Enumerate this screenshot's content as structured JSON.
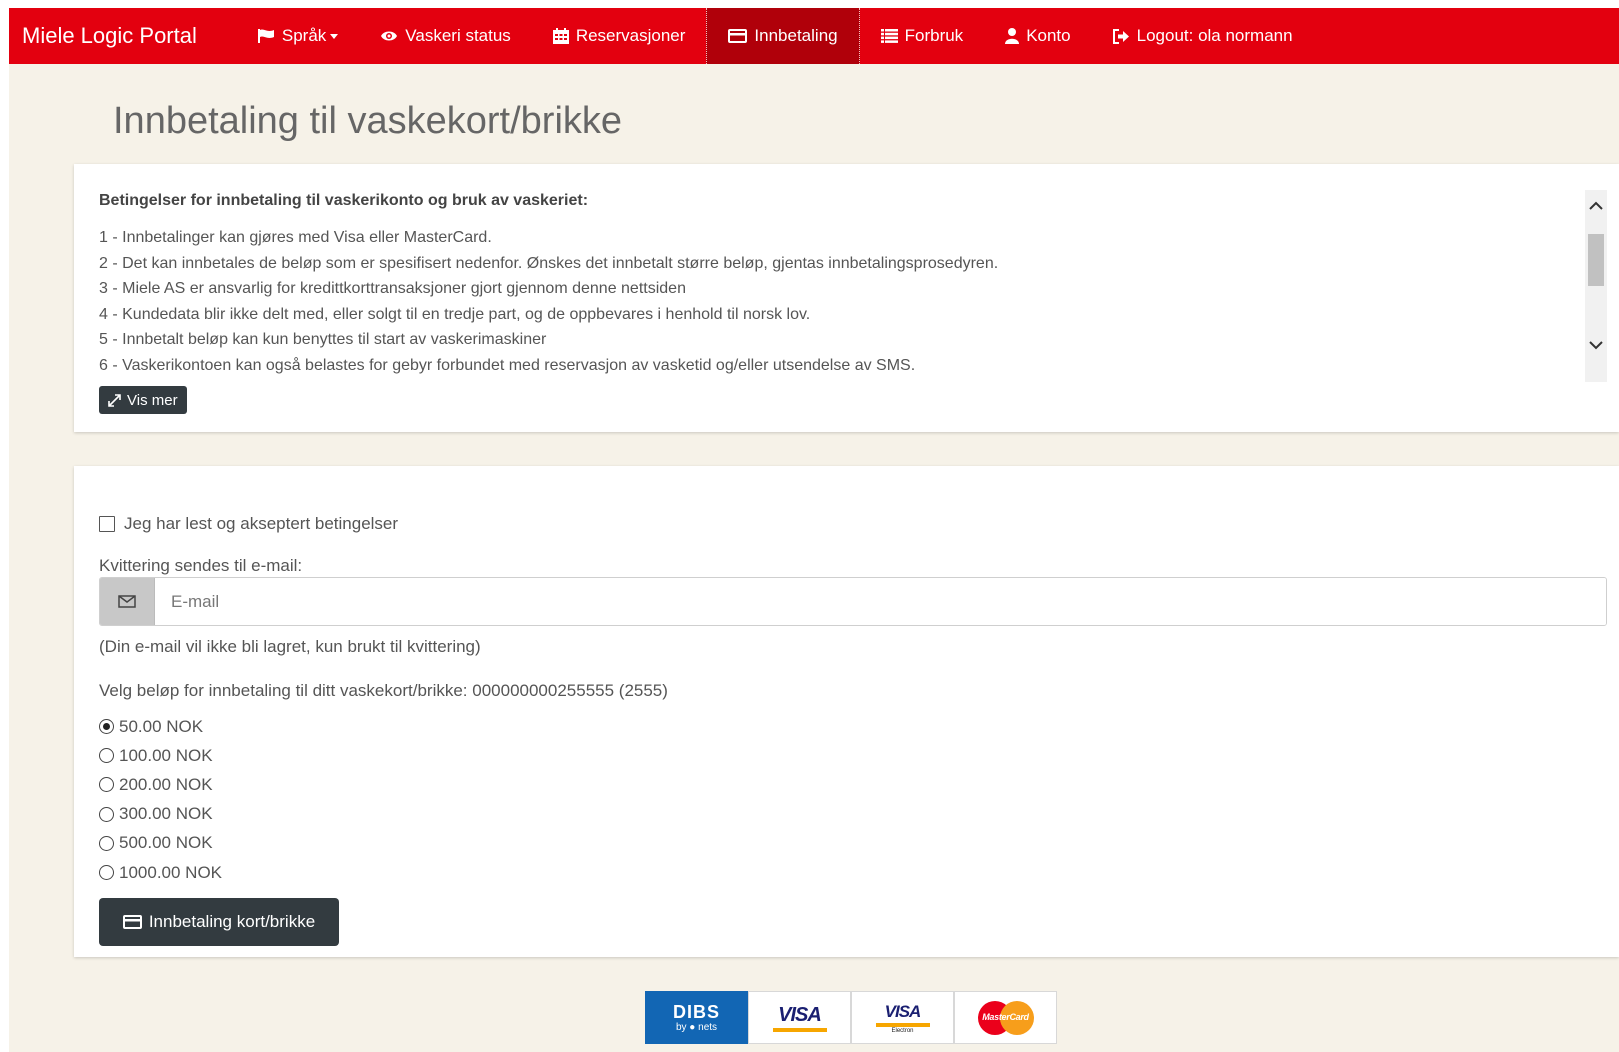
{
  "nav": {
    "brand": "Miele Logic Portal",
    "items": [
      {
        "label": "Språk",
        "icon": "flag-icon"
      },
      {
        "label": "Vaskeri status",
        "icon": "eye-icon"
      },
      {
        "label": "Reservasjoner",
        "icon": "calendar-icon"
      },
      {
        "label": "Innbetaling",
        "icon": "credit-card-icon",
        "active": true
      },
      {
        "label": "Forbruk",
        "icon": "list-icon"
      },
      {
        "label": "Konto",
        "icon": "user-icon"
      },
      {
        "label": "Logout: ola normann",
        "icon": "logout-icon"
      }
    ],
    "colors": {
      "bar": "#e3000f",
      "active": "#b0000a"
    }
  },
  "page": {
    "title": "Innbetaling til vaskekort/brikke"
  },
  "terms": {
    "title": "Betingelser for innbetaling til vaskerikonto og bruk av vaskeriet:",
    "lines": [
      "1 - Innbetalinger kan gjøres med Visa eller MasterCard.",
      "2 - Det kan innbetales de beløp som er spesifisert nedenfor. Ønskes det innbetalt større beløp, gjentas innbetalingsprosedyren.",
      "3 - Miele AS er ansvarlig for kredittkorttransaksjoner gjort gjennom denne nettsiden",
      "4 - Kundedata blir ikke delt med, eller solgt til en tredje part, og de oppbevares i henhold til norsk lov.",
      "5 - Innbetalt beløp kan kun benyttes til start av vaskerimaskiner",
      "6 - Vaskerikontoen kan også belastes for gebyr forbundet med reservasjon av vasketid og/eller utsendelse av SMS."
    ],
    "show_more_label": "Vis mer"
  },
  "form": {
    "accept_label": "Jeg har lest og akseptert betingelser",
    "accept_checked": false,
    "email_label": "Kvittering sendes til e-mail:",
    "email_placeholder": "E-mail",
    "email_value": "",
    "email_hint": "(Din e-mail vil ikke bli lagret, kun brukt til kvittering)",
    "amount_label": "Velg beløp for innbetaling til ditt vaskekort/brikke: 000000000255555 (2555)",
    "amounts": [
      "50.00 NOK",
      "100.00 NOK",
      "200.00 NOK",
      "300.00 NOK",
      "500.00 NOK",
      "1000.00 NOK"
    ],
    "selected_amount": "50.00 NOK",
    "submit_label": "Innbetaling kort/brikke"
  },
  "payment_logos": {
    "dibs": {
      "main": "DIBS",
      "sub": "by ● nets"
    },
    "visa": "VISA",
    "visa_electron": {
      "main": "VISA",
      "sub": "Electron"
    },
    "mastercard": "MasterCard"
  }
}
